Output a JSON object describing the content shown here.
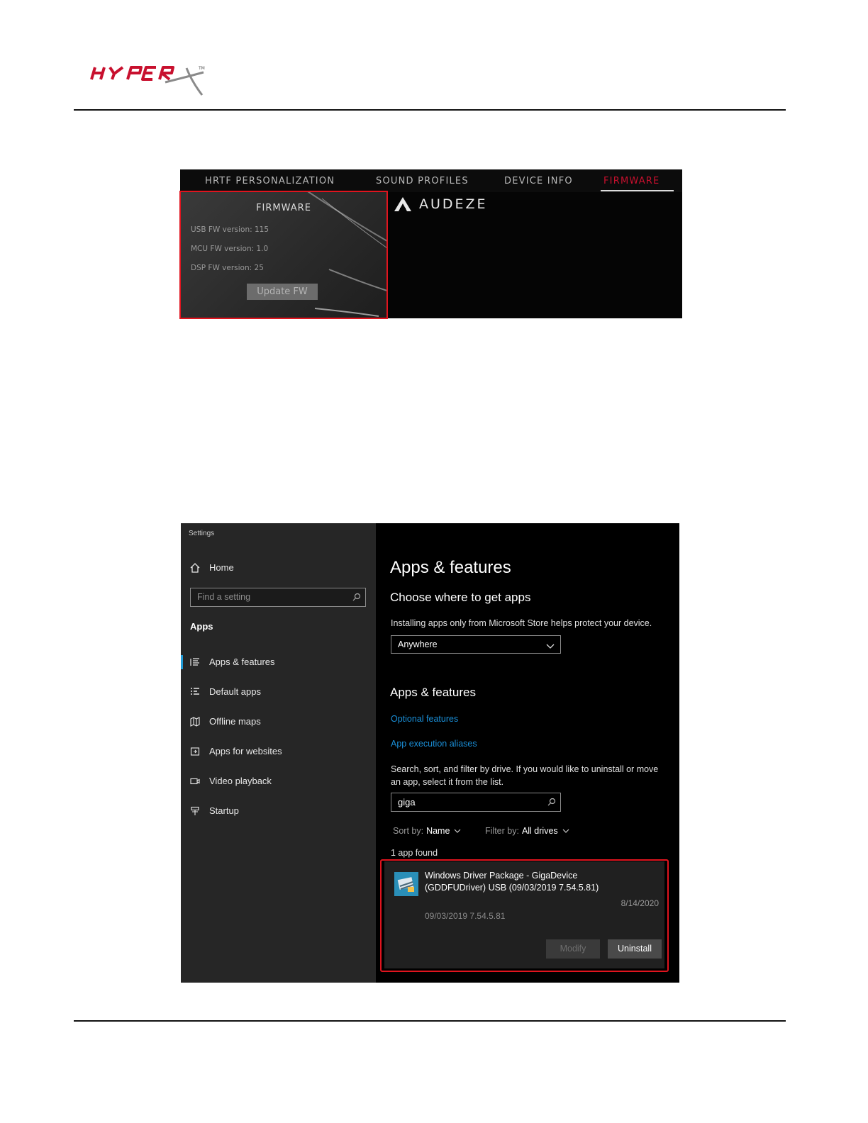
{
  "header": {
    "logo_text": "HYPERX"
  },
  "firmware_screen": {
    "tabs": [
      {
        "label": "HRTF PERSONALIZATION"
      },
      {
        "label": "SOUND PROFILES"
      },
      {
        "label": "DEVICE INFO"
      },
      {
        "label": "FIRMWARE",
        "active": true
      }
    ],
    "panel_title": "FIRMWARE",
    "usb_fw": "USB FW version: 115",
    "mcu_fw": "MCU FW version: 1.0",
    "dsp_fw": "DSP FW version: 25",
    "update_button": "Update FW",
    "brand": "AUDEZE",
    "accent_color": "#c8102e"
  },
  "settings_screen": {
    "window_title": "Settings",
    "sidebar": {
      "home_label": "Home",
      "search_placeholder": "Find a setting",
      "section_header": "Apps",
      "items": [
        {
          "label": "Apps & features",
          "icon": "list-icon",
          "selected": true
        },
        {
          "label": "Default apps",
          "icon": "default-apps-icon"
        },
        {
          "label": "Offline maps",
          "icon": "map-icon"
        },
        {
          "label": "Apps for websites",
          "icon": "website-icon"
        },
        {
          "label": "Video playback",
          "icon": "video-icon"
        },
        {
          "label": "Startup",
          "icon": "startup-icon"
        }
      ]
    },
    "main": {
      "title": "Apps & features",
      "choose_heading": "Choose where to get apps",
      "choose_desc": "Installing apps only from Microsoft Store helps protect your device.",
      "source_dropdown": "Anywhere",
      "apps_heading": "Apps & features",
      "links": [
        "Optional features",
        "App execution aliases"
      ],
      "search_desc": "Search, sort, and filter by drive. If you would like to uninstall or move an app, select it from the list.",
      "search_value": "giga",
      "sort_label": "Sort by:",
      "sort_value": "Name",
      "filter_label": "Filter by:",
      "filter_value": "All drives",
      "result_count": "1 app found",
      "app": {
        "name": "Windows Driver Package - GigaDevice (GDDFUDriver) USB  (09/03/2019 7.54.5.81)",
        "date": "8/14/2020",
        "version": "09/03/2019 7.54.5.81",
        "modify_button": "Modify",
        "uninstall_button": "Uninstall"
      },
      "link_color": "#1a8fd8",
      "highlight_color": "#e0141e"
    }
  }
}
